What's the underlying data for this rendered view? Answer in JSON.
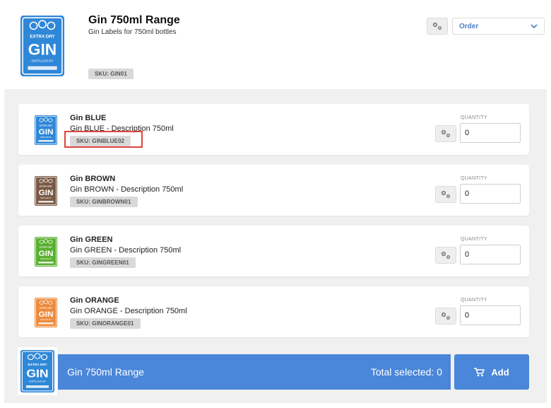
{
  "product": {
    "title": "Gin 750ml Range",
    "subtitle": "Gin Labels for 750ml bottles",
    "sku": "SKU: GIN01",
    "thumb_color": "#2f87d8",
    "thumb_text": {
      "top": "EXTRA DRY",
      "big": "GIN",
      "bottom": "DISTILLED BY"
    }
  },
  "toolbar": {
    "settings_icon": "gear-icon",
    "order_select_value": "Order"
  },
  "variants": [
    {
      "name": "Gin BLUE",
      "description": "Gin BLUE - Description 750ml",
      "sku": "SKU: GINBLUE02",
      "quantity_label": "QUANTITY",
      "quantity": "0",
      "color": "#2f87d8"
    },
    {
      "name": "Gin BROWN",
      "description": "Gin BROWN - Description 750ml",
      "sku": "SKU: GINBROWN01",
      "quantity_label": "QUANTITY",
      "quantity": "0",
      "color": "#7a5a45"
    },
    {
      "name": "Gin GREEN",
      "description": "Gin GREEN - Description 750ml",
      "sku": "SKU: GINGREEN01",
      "quantity_label": "QUANTITY",
      "quantity": "0",
      "color": "#58b030"
    },
    {
      "name": "Gin ORANGE",
      "description": "Gin ORANGE - Description 750ml",
      "sku": "SKU: GINORANGE01",
      "quantity_label": "QUANTITY",
      "quantity": "0",
      "color": "#ee8a3c"
    }
  ],
  "footer": {
    "product_name": "Gin 750ml Range",
    "total_selected": "Total selected: 0",
    "add_label": "Add",
    "bar_color": "#4a86d9"
  },
  "highlight_color": "#e0443c"
}
